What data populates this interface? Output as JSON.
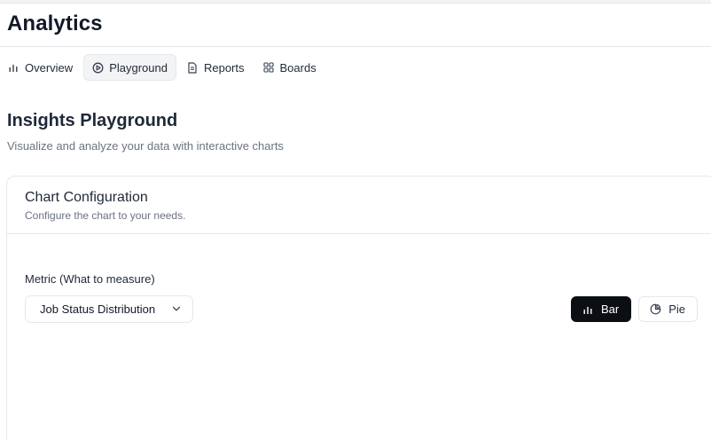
{
  "app": {
    "title": "Analytics"
  },
  "tabs": [
    {
      "label": "Overview",
      "icon": "bar-chart-icon",
      "active": false
    },
    {
      "label": "Playground",
      "icon": "play-circle-icon",
      "active": true
    },
    {
      "label": "Reports",
      "icon": "file-text-icon",
      "active": false
    },
    {
      "label": "Boards",
      "icon": "grid-icon",
      "active": false
    }
  ],
  "page": {
    "title": "Insights Playground",
    "subtitle": "Visualize and analyze your data with interactive charts"
  },
  "config_card": {
    "title": "Chart Configuration",
    "subtitle": "Configure the chart to your needs.",
    "metric_label": "Metric (What to measure)",
    "metric_value": "Job Status Distribution",
    "chart_types": [
      {
        "label": "Bar",
        "icon": "bar-chart-icon",
        "active": true
      },
      {
        "label": "Pie",
        "icon": "pie-chart-icon",
        "active": false
      }
    ]
  },
  "colors": {
    "accent_dark": "#0b0f14",
    "border": "#e5e7eb",
    "muted_text": "#6b7280"
  }
}
